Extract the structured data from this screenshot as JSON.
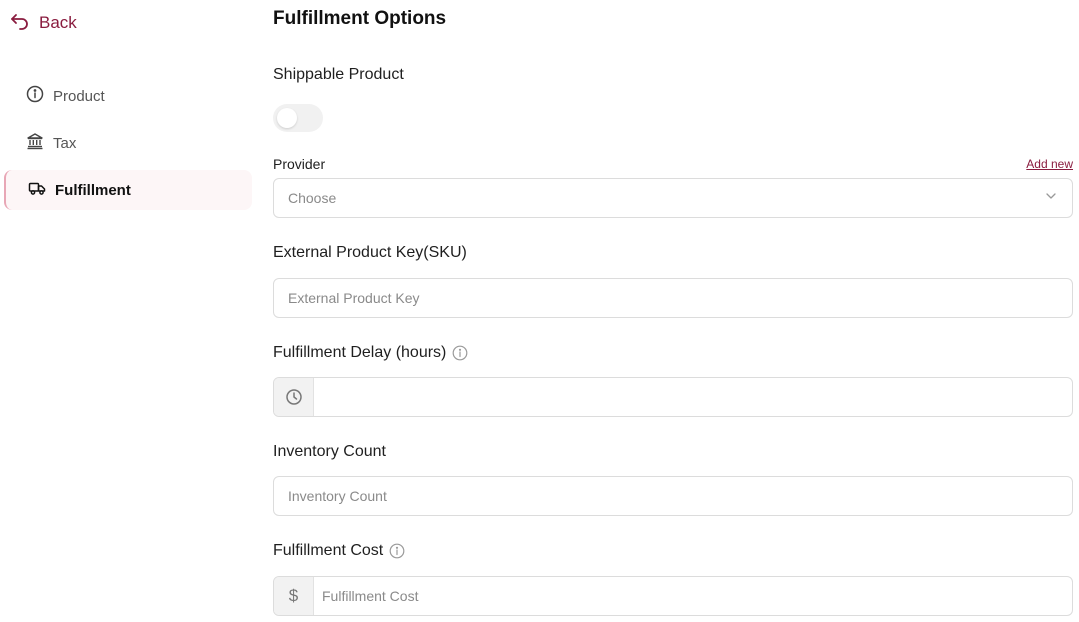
{
  "sidebar": {
    "back_label": "Back",
    "items": [
      {
        "label": "Product",
        "icon": "info-circle-icon"
      },
      {
        "label": "Tax",
        "icon": "bank-icon"
      },
      {
        "label": "Fulfillment",
        "icon": "truck-icon",
        "active": true
      }
    ]
  },
  "main": {
    "title": "Fulfillment Options",
    "shippable": {
      "label": "Shippable Product",
      "enabled": false
    },
    "provider": {
      "label": "Provider",
      "add_new": "Add new",
      "placeholder": "Choose"
    },
    "sku": {
      "label": "External Product Key(SKU)",
      "placeholder": "External Product Key"
    },
    "delay": {
      "label": "Fulfillment Delay (hours)",
      "placeholder": ""
    },
    "inventory": {
      "label": "Inventory Count",
      "placeholder": "Inventory Count"
    },
    "cost": {
      "label": "Fulfillment Cost",
      "placeholder": "Fulfillment Cost",
      "addon": "$"
    }
  },
  "colors": {
    "accent": "#8a1c3f",
    "active_bg": "#fdf6f7"
  }
}
